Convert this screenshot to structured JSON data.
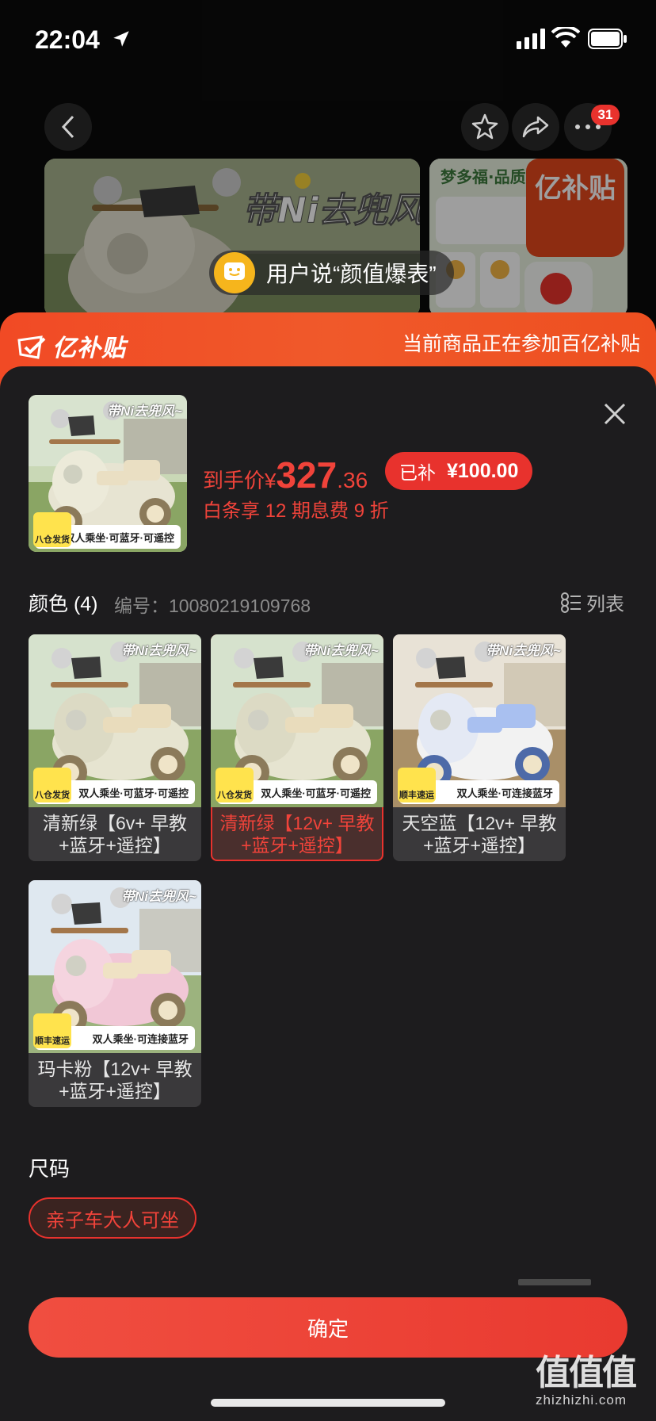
{
  "status_bar": {
    "time": "22:04"
  },
  "nav": {
    "badge_count": "31"
  },
  "gallery": {
    "user_says": "用户说“颜值爆表”",
    "side_badge": "亿补贴"
  },
  "subsidy_banner": {
    "logo": "亿补贴",
    "note": "当前商品正在参加百亿补贴"
  },
  "product": {
    "price_prefix": "到手价¥",
    "price_int": "327",
    "price_dec": ".36",
    "subsidy_label": "已补",
    "subsidy_amount": "¥100.00",
    "installment": "白条享 12 期息费 9 折"
  },
  "color_section": {
    "title": "颜色 (4)",
    "code": "编号：10080219109768",
    "list_label": "列表"
  },
  "variants": [
    {
      "label": "清新绿【6v+ 早教+蓝牙+遥控】",
      "caption": "双人乘坐·可蓝牙·可遥控",
      "title": "带Ni去兜风~",
      "tag": "八仓发货",
      "theme": "green",
      "selected": false
    },
    {
      "label": "清新绿【12v+ 早教+蓝牙+遥控】",
      "caption": "双人乘坐·可蓝牙·可遥控",
      "title": "带Ni去兜风~",
      "tag": "八仓发货",
      "theme": "green",
      "selected": true
    },
    {
      "label": "天空蓝【12v+ 早教+蓝牙+遥控】",
      "caption": "双人乘坐·可连接蓝牙",
      "title": "带Ni去兜风~",
      "tag": "顺丰速运",
      "theme": "blue",
      "selected": false
    },
    {
      "label": "玛卡粉【12v+ 早教+蓝牙+遥控】",
      "caption": "双人乘坐·可连接蓝牙",
      "title": "带Ni去兜风~",
      "tag": "顺丰速运",
      "theme": "pink",
      "selected": false
    }
  ],
  "thumb": {
    "caption": "双人乘坐·可蓝牙·可遥控",
    "title": "带Ni去兜风~",
    "tag": "八仓发货"
  },
  "size_section": {
    "title": "尺码",
    "option": "亲子车大人可坐"
  },
  "confirm_label": "确定",
  "watermark": {
    "main": "值值值",
    "sub": "zhizhizhi.com"
  },
  "colors": {
    "accent": "#e8322d",
    "sheet_bg": "#1d1c1e",
    "tile_bg": "#3a393b"
  }
}
